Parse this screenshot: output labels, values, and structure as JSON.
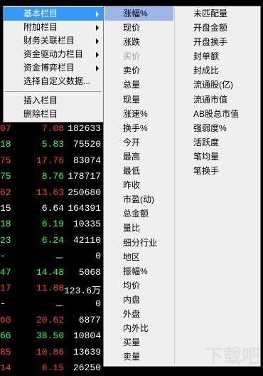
{
  "background_rows": [
    {
      "code": "07",
      "price": "7.08",
      "vol": "182633",
      "color": "#ff3b3b"
    },
    {
      "code": "18",
      "price": "5.83",
      "vol": "75520",
      "color": "#3cff3c"
    },
    {
      "code": "75",
      "price": "17.76",
      "vol": "83074",
      "color": "#ff3b3b"
    },
    {
      "code": "75",
      "price": "8.76",
      "vol": "178717",
      "color": "#3cff3c"
    },
    {
      "code": "62",
      "price": "13.63",
      "vol": "250680",
      "color": "#ff3b3b"
    },
    {
      "code": "15",
      "price": "6.64",
      "vol": "164391",
      "color": "#ffffff"
    },
    {
      "code": "18",
      "price": "6.19",
      "vol": "10335",
      "color": "#3cff3c"
    },
    {
      "code": "23",
      "price": "6.24",
      "vol": "42110",
      "color": "#3cff3c"
    },
    {
      "code": "-",
      "price": "－",
      "vol": "0",
      "color": "#ffffff"
    },
    {
      "code": "47",
      "price": "14.48",
      "vol": "5068",
      "color": "#3cff3c"
    },
    {
      "code": "17",
      "price": "11.88",
      "vol": "123.6万",
      "color": "#ff3b3b"
    },
    {
      "code": "-",
      "price": "－",
      "vol": "0",
      "color": "#ffffff"
    },
    {
      "code": "60",
      "price": "20.62",
      "vol": "6877",
      "color": "#ff3b3b"
    },
    {
      "code": "66",
      "price": "38.50",
      "vol": "10804",
      "color": "#3cff3c"
    },
    {
      "code": "85",
      "price": "10.86",
      "vol": "13639",
      "color": "#ff3b3b"
    },
    {
      "code": "14",
      "price": "6.15",
      "vol": "26250",
      "color": "#ff3b3b"
    }
  ],
  "menu_level1": {
    "items": [
      {
        "label": "基本栏目",
        "submenu": true,
        "active": true
      },
      {
        "label": "附加栏目",
        "submenu": true
      },
      {
        "label": "财务关联栏目",
        "submenu": true
      },
      {
        "label": "资金驱动力栏目",
        "submenu": true
      },
      {
        "label": "资金博弈栏目",
        "submenu": true
      },
      {
        "label": "选择自定义数据...",
        "submenu": false
      }
    ],
    "items_after_sep": [
      {
        "label": "插入栏目"
      },
      {
        "label": "删除栏目"
      }
    ]
  },
  "menu_level2": {
    "column1": [
      {
        "label": "涨幅%",
        "highlighted": true
      },
      {
        "label": "现价"
      },
      {
        "label": "涨跌"
      },
      {
        "label": "买价",
        "disabled": true
      },
      {
        "label": "卖价"
      },
      {
        "label": "总量"
      },
      {
        "label": "现量"
      },
      {
        "label": "涨速%"
      },
      {
        "label": "换手%"
      },
      {
        "label": "今开"
      },
      {
        "label": "最高"
      },
      {
        "label": "最低"
      },
      {
        "label": "昨收"
      },
      {
        "label": "市盈(动)"
      },
      {
        "label": "总金额"
      },
      {
        "label": "量比"
      },
      {
        "label": "细分行业"
      },
      {
        "label": "地区"
      },
      {
        "label": "振幅%"
      },
      {
        "label": "均价"
      },
      {
        "label": "内盘"
      },
      {
        "label": "外盘"
      },
      {
        "label": "内外比"
      },
      {
        "label": "买量"
      },
      {
        "label": "卖量"
      }
    ],
    "column2": [
      {
        "label": "未匹配量"
      },
      {
        "label": "开盘金额"
      },
      {
        "label": "开盘换手"
      },
      {
        "label": "封单额"
      },
      {
        "label": "封成比"
      },
      {
        "label": "流通股(亿)"
      },
      {
        "label": "流通市值"
      },
      {
        "label": "AB股总市值"
      },
      {
        "label": "强弱度%"
      },
      {
        "label": "活跃度"
      },
      {
        "label": "笔均量"
      },
      {
        "label": "笔换手"
      }
    ]
  }
}
